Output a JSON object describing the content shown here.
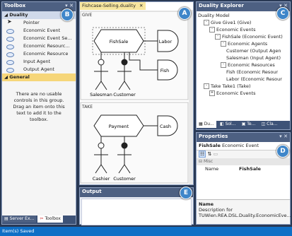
{
  "toolbox": {
    "title": "Toolbox",
    "group_duality": "Duality",
    "items": [
      {
        "label": "Pointer",
        "icon": "pointer-arrow-icon"
      },
      {
        "label": "Economic Event",
        "icon": "ellipse-icon"
      },
      {
        "label": "Economic Event Se...",
        "icon": "ellipse-icon"
      },
      {
        "label": "Economic Resourc...",
        "icon": "ellipse-icon"
      },
      {
        "label": "Economic Resource",
        "icon": "ellipse-icon"
      },
      {
        "label": "Input Agent",
        "icon": "ellipse-icon"
      },
      {
        "label": "Output Agent",
        "icon": "ellipse-icon"
      }
    ],
    "group_general": "General",
    "empty_text": "There are no usable controls in this group. Drag an item onto this text to add it to the toolbox.",
    "bottom_tabs": [
      "Server Ex...",
      "Toolbox"
    ]
  },
  "editor": {
    "tab_title": "Fishcase-Selling.duality",
    "give_label": "GIVE",
    "take_label": "TAKE",
    "give": {
      "event": "FishSale",
      "resource_a": "Labor",
      "resource_b": "Fish",
      "agent_a": "Salesman",
      "agent_b": "Customer"
    },
    "take": {
      "event": "Payment",
      "resource_a": "Cash",
      "agent_a": "Cashier",
      "agent_b": "Customer"
    }
  },
  "explorer": {
    "title": "Duality Explorer",
    "nodes": [
      {
        "text": "Duality Model",
        "indent": 0,
        "exp": ""
      },
      {
        "text": "Give Give1 (Give)",
        "indent": 1,
        "exp": "-"
      },
      {
        "text": "Economic Events",
        "indent": 2,
        "exp": "-"
      },
      {
        "text": "FishSale (Economic Event)",
        "indent": 3,
        "exp": "-"
      },
      {
        "text": "Economic Agents",
        "indent": 4,
        "exp": "-"
      },
      {
        "text": "Customer (Output Agen",
        "indent": 5,
        "exp": ""
      },
      {
        "text": "Salesman (Input Agent)",
        "indent": 5,
        "exp": ""
      },
      {
        "text": "Economic Resources",
        "indent": 4,
        "exp": "-"
      },
      {
        "text": "Fish (Economic Resour",
        "indent": 5,
        "exp": ""
      },
      {
        "text": "Labor (Economic Resour",
        "indent": 5,
        "exp": ""
      },
      {
        "text": "Take Take1 (Take)",
        "indent": 1,
        "exp": "-"
      },
      {
        "text": "Economic Events",
        "indent": 2,
        "exp": "+"
      }
    ],
    "tabs": [
      "Du...",
      "Sol...",
      "Te...",
      "Cla..."
    ]
  },
  "properties": {
    "title": "Properties",
    "object_name": "FishSale",
    "object_type": "Economic Event",
    "category": "Misc",
    "prop_name": "Name",
    "prop_value": "FishSale",
    "desc_title": "Name",
    "desc_text": "Description for TUWien.REA.DSL.Duality.EconomicEve..."
  },
  "output": {
    "title": "Output"
  },
  "status": {
    "text": "Item(s) Saved"
  },
  "badges": [
    "A",
    "B",
    "C",
    "D",
    "E"
  ],
  "colors": {
    "accent_badge": "#3f86c9",
    "title_bar": "#4d6082",
    "background": "#293955"
  }
}
